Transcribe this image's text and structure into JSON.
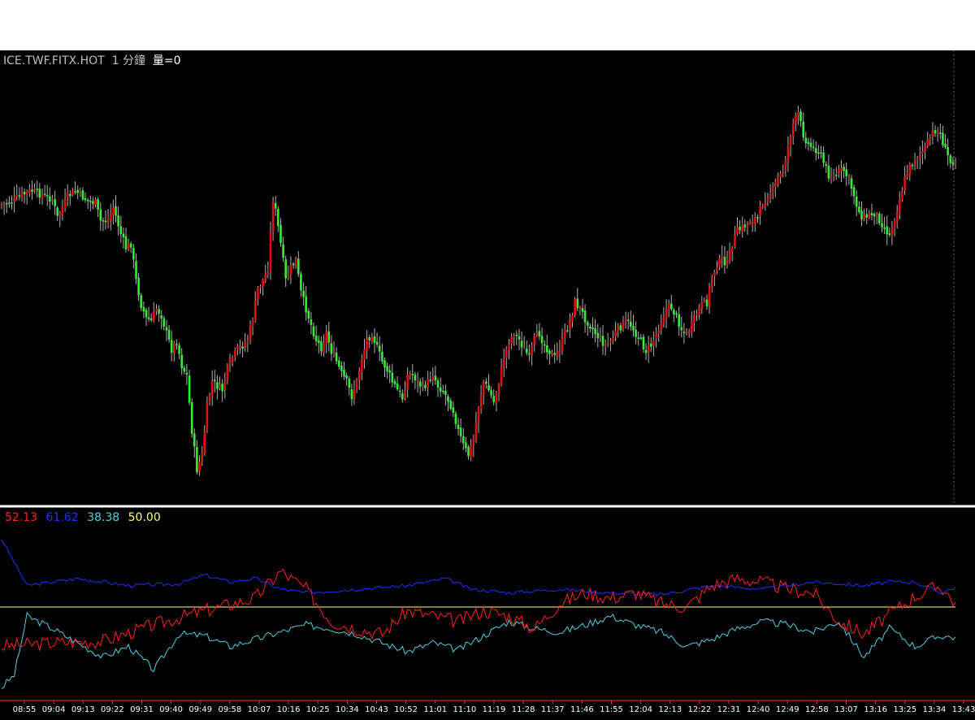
{
  "header": {
    "symbol": "ICE.TWF.FITX.HOT",
    "interval": "1 分鐘",
    "volume": "量=0"
  },
  "indicator_legend": {
    "red_value": "52.13",
    "blue_value": "61.62",
    "cyan_value": "38.38",
    "yellow_value": "50.00"
  },
  "colors": {
    "background": "#000000",
    "up_candle": "#e01010",
    "down_candle": "#33ee33",
    "wick": "#b0b0b0",
    "red_line": "#ff2020",
    "blue_line": "#2030ff",
    "cyan_line": "#50d0e0",
    "yellow_line": "#ffff80",
    "separator": "#ffffff",
    "axis_line": "#ff3030"
  },
  "chart_data": [
    {
      "type": "candlestick",
      "title": "ICE.TWF.FITX.HOT 1 分鐘",
      "x_tick_labels": [
        "08:55",
        "09:04",
        "09:13",
        "09:22",
        "09:31",
        "09:40",
        "09:49",
        "09:58",
        "10:07",
        "10:16",
        "10:25",
        "10:34",
        "10:43",
        "10:52",
        "11:01",
        "11:10",
        "11:19",
        "11:28",
        "11:37",
        "11:46",
        "11:55",
        "12:04",
        "12:13",
        "12:22",
        "12:31",
        "12:40",
        "12:49",
        "12:58",
        "13:07",
        "13:16",
        "13:25",
        "13:34",
        "13:43"
      ],
      "close_path": [
        [
          0,
          252
        ],
        [
          4,
          248
        ],
        [
          8,
          240
        ],
        [
          12,
          235
        ],
        [
          16,
          240
        ],
        [
          20,
          245
        ],
        [
          22,
          268
        ],
        [
          26,
          242
        ],
        [
          29,
          235
        ],
        [
          33,
          245
        ],
        [
          37,
          250
        ],
        [
          39,
          272
        ],
        [
          42,
          270
        ],
        [
          44,
          255
        ],
        [
          47,
          288
        ],
        [
          49,
          305
        ],
        [
          51,
          300
        ],
        [
          53,
          345
        ],
        [
          55,
          375
        ],
        [
          57,
          392
        ],
        [
          59,
          395
        ],
        [
          61,
          380
        ],
        [
          63,
          388
        ],
        [
          65,
          410
        ],
        [
          67,
          430
        ],
        [
          69,
          420
        ],
        [
          71,
          450
        ],
        [
          73,
          462
        ],
        [
          75,
          530
        ],
        [
          77,
          578
        ],
        [
          79,
          560
        ],
        [
          81,
          500
        ],
        [
          83,
          470
        ],
        [
          85,
          475
        ],
        [
          87,
          480
        ],
        [
          89,
          455
        ],
        [
          91,
          440
        ],
        [
          93,
          430
        ],
        [
          95,
          425
        ],
        [
          97,
          418
        ],
        [
          99,
          392
        ],
        [
          101,
          355
        ],
        [
          103,
          345
        ],
        [
          105,
          330
        ],
        [
          107,
          245
        ],
        [
          108,
          260
        ],
        [
          110,
          300
        ],
        [
          112,
          345
        ],
        [
          114,
          330
        ],
        [
          116,
          320
        ],
        [
          118,
          360
        ],
        [
          120,
          380
        ],
        [
          122,
          400
        ],
        [
          124,
          418
        ],
        [
          126,
          428
        ],
        [
          128,
          410
        ],
        [
          130,
          432
        ],
        [
          132,
          445
        ],
        [
          134,
          460
        ],
        [
          136,
          470
        ],
        [
          138,
          488
        ],
        [
          140,
          470
        ],
        [
          142,
          440
        ],
        [
          144,
          418
        ],
        [
          146,
          410
        ],
        [
          148,
          428
        ],
        [
          150,
          445
        ],
        [
          152,
          455
        ],
        [
          154,
          470
        ],
        [
          156,
          480
        ],
        [
          158,
          490
        ],
        [
          160,
          462
        ],
        [
          162,
          460
        ],
        [
          164,
          470
        ],
        [
          166,
          478
        ],
        [
          168,
          470
        ],
        [
          170,
          460
        ],
        [
          172,
          475
        ],
        [
          174,
          480
        ],
        [
          176,
          492
        ],
        [
          178,
          505
        ],
        [
          180,
          530
        ],
        [
          182,
          548
        ],
        [
          184,
          560
        ],
        [
          186,
          540
        ],
        [
          188,
          500
        ],
        [
          190,
          470
        ],
        [
          192,
          480
        ],
        [
          194,
          495
        ],
        [
          196,
          470
        ],
        [
          198,
          440
        ],
        [
          200,
          420
        ],
        [
          202,
          410
        ],
        [
          204,
          418
        ],
        [
          206,
          430
        ],
        [
          208,
          440
        ],
        [
          210,
          418
        ],
        [
          212,
          410
        ],
        [
          214,
          425
        ],
        [
          216,
          432
        ],
        [
          218,
          440
        ],
        [
          220,
          428
        ],
        [
          222,
          410
        ],
        [
          224,
          395
        ],
        [
          226,
          372
        ],
        [
          228,
          380
        ],
        [
          230,
          392
        ],
        [
          232,
          400
        ],
        [
          234,
          410
        ],
        [
          236,
          418
        ],
        [
          238,
          425
        ],
        [
          240,
          420
        ],
        [
          242,
          410
        ],
        [
          244,
          402
        ],
        [
          246,
          395
        ],
        [
          248,
          400
        ],
        [
          250,
          410
        ],
        [
          252,
          420
        ],
        [
          254,
          432
        ],
        [
          256,
          425
        ],
        [
          258,
          410
        ],
        [
          260,
          395
        ],
        [
          262,
          380
        ],
        [
          264,
          378
        ],
        [
          266,
          390
        ],
        [
          268,
          405
        ],
        [
          270,
          412
        ],
        [
          272,
          400
        ],
        [
          274,
          385
        ],
        [
          276,
          375
        ],
        [
          278,
          372
        ],
        [
          280,
          340
        ],
        [
          282,
          325
        ],
        [
          284,
          318
        ],
        [
          286,
          325
        ],
        [
          288,
          300
        ],
        [
          290,
          285
        ],
        [
          292,
          280
        ],
        [
          294,
          275
        ],
        [
          296,
          270
        ],
        [
          298,
          268
        ],
        [
          300,
          250
        ],
        [
          302,
          240
        ],
        [
          304,
          235
        ],
        [
          306,
          220
        ],
        [
          308,
          210
        ],
        [
          310,
          180
        ],
        [
          312,
          152
        ],
        [
          314,
          140
        ],
        [
          316,
          165
        ],
        [
          318,
          178
        ],
        [
          320,
          182
        ],
        [
          322,
          185
        ],
        [
          324,
          200
        ],
        [
          326,
          215
        ],
        [
          328,
          218
        ],
        [
          330,
          212
        ],
        [
          332,
          210
        ],
        [
          334,
          222
        ],
        [
          336,
          240
        ],
        [
          338,
          262
        ],
        [
          340,
          268
        ],
        [
          342,
          265
        ],
        [
          344,
          262
        ],
        [
          346,
          270
        ],
        [
          348,
          280
        ],
        [
          350,
          290
        ],
        [
          352,
          268
        ],
        [
          354,
          245
        ],
        [
          356,
          220
        ],
        [
          358,
          205
        ],
        [
          360,
          195
        ],
        [
          362,
          190
        ],
        [
          364,
          182
        ],
        [
          366,
          170
        ],
        [
          368,
          160
        ],
        [
          370,
          165
        ],
        [
          372,
          185
        ],
        [
          374,
          200
        ],
        [
          376,
          195
        ]
      ],
      "price_axis_range": [
        0,
        1
      ],
      "grid": false
    },
    {
      "type": "line",
      "series": [
        {
          "name": "52.13",
          "color": "red"
        },
        {
          "name": "61.62",
          "color": "blue"
        },
        {
          "name": "38.38",
          "color": "cyan"
        },
        {
          "name": "50.00",
          "color": "yellow"
        }
      ],
      "reference_level": 50.0,
      "ylim": [
        0,
        100
      ],
      "red_path": [
        [
          0,
          28
        ],
        [
          20,
          30
        ],
        [
          40,
          31
        ],
        [
          60,
          40
        ],
        [
          80,
          48
        ],
        [
          100,
          55
        ],
        [
          110,
          70
        ],
        [
          120,
          60
        ],
        [
          130,
          42
        ],
        [
          140,
          38
        ],
        [
          150,
          35
        ],
        [
          160,
          48
        ],
        [
          170,
          45
        ],
        [
          180,
          42
        ],
        [
          190,
          48
        ],
        [
          200,
          45
        ],
        [
          210,
          38
        ],
        [
          220,
          52
        ],
        [
          230,
          58
        ],
        [
          240,
          55
        ],
        [
          250,
          58
        ],
        [
          260,
          52
        ],
        [
          270,
          50
        ],
        [
          280,
          62
        ],
        [
          290,
          66
        ],
        [
          300,
          64
        ],
        [
          310,
          60
        ],
        [
          320,
          58
        ],
        [
          330,
          42
        ],
        [
          340,
          35
        ],
        [
          350,
          46
        ],
        [
          360,
          56
        ],
        [
          370,
          62
        ],
        [
          376,
          52
        ]
      ],
      "blue_path": [
        [
          0,
          88
        ],
        [
          10,
          62
        ],
        [
          30,
          66
        ],
        [
          50,
          62
        ],
        [
          70,
          63
        ],
        [
          80,
          68
        ],
        [
          90,
          64
        ],
        [
          100,
          66
        ],
        [
          110,
          60
        ],
        [
          120,
          58
        ],
        [
          140,
          60
        ],
        [
          160,
          62
        ],
        [
          175,
          66
        ],
        [
          185,
          60
        ],
        [
          200,
          58
        ],
        [
          220,
          60
        ],
        [
          240,
          58
        ],
        [
          260,
          57
        ],
        [
          280,
          62
        ],
        [
          300,
          60
        ],
        [
          310,
          62
        ],
        [
          320,
          64
        ],
        [
          340,
          62
        ],
        [
          350,
          64
        ],
        [
          360,
          64
        ],
        [
          370,
          58
        ],
        [
          376,
          61
        ]
      ],
      "cyan_path": [
        [
          0,
          5
        ],
        [
          5,
          12
        ],
        [
          10,
          45
        ],
        [
          20,
          38
        ],
        [
          30,
          30
        ],
        [
          40,
          22
        ],
        [
          50,
          28
        ],
        [
          60,
          15
        ],
        [
          70,
          35
        ],
        [
          80,
          34
        ],
        [
          90,
          28
        ],
        [
          100,
          32
        ],
        [
          110,
          36
        ],
        [
          120,
          40
        ],
        [
          130,
          38
        ],
        [
          140,
          35
        ],
        [
          150,
          30
        ],
        [
          160,
          25
        ],
        [
          170,
          30
        ],
        [
          180,
          26
        ],
        [
          190,
          34
        ],
        [
          200,
          42
        ],
        [
          210,
          38
        ],
        [
          220,
          36
        ],
        [
          230,
          40
        ],
        [
          240,
          45
        ],
        [
          250,
          40
        ],
        [
          260,
          36
        ],
        [
          270,
          28
        ],
        [
          280,
          32
        ],
        [
          290,
          38
        ],
        [
          300,
          42
        ],
        [
          310,
          40
        ],
        [
          320,
          36
        ],
        [
          330,
          42
        ],
        [
          340,
          22
        ],
        [
          350,
          38
        ],
        [
          360,
          28
        ],
        [
          370,
          34
        ],
        [
          376,
          33
        ]
      ]
    }
  ]
}
